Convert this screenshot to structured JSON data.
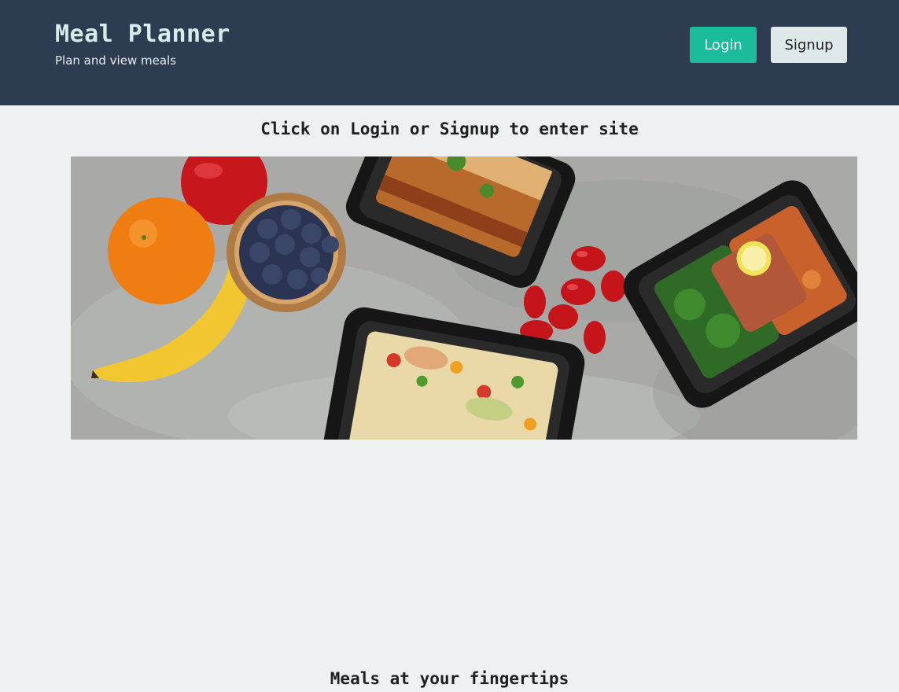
{
  "header": {
    "title": "Meal Planner",
    "subtitle": "Plan and view meals",
    "login_label": "Login",
    "signup_label": "Signup"
  },
  "main": {
    "instruction": "Click on Login or Signup to enter site",
    "hero_image": "meal-prep-food-photo",
    "section_heading": "Meals at your fingertips"
  },
  "colors": {
    "header_bg": "#2d3c50",
    "accent": "#1abc9c",
    "page_bg": "#eff0f2"
  }
}
